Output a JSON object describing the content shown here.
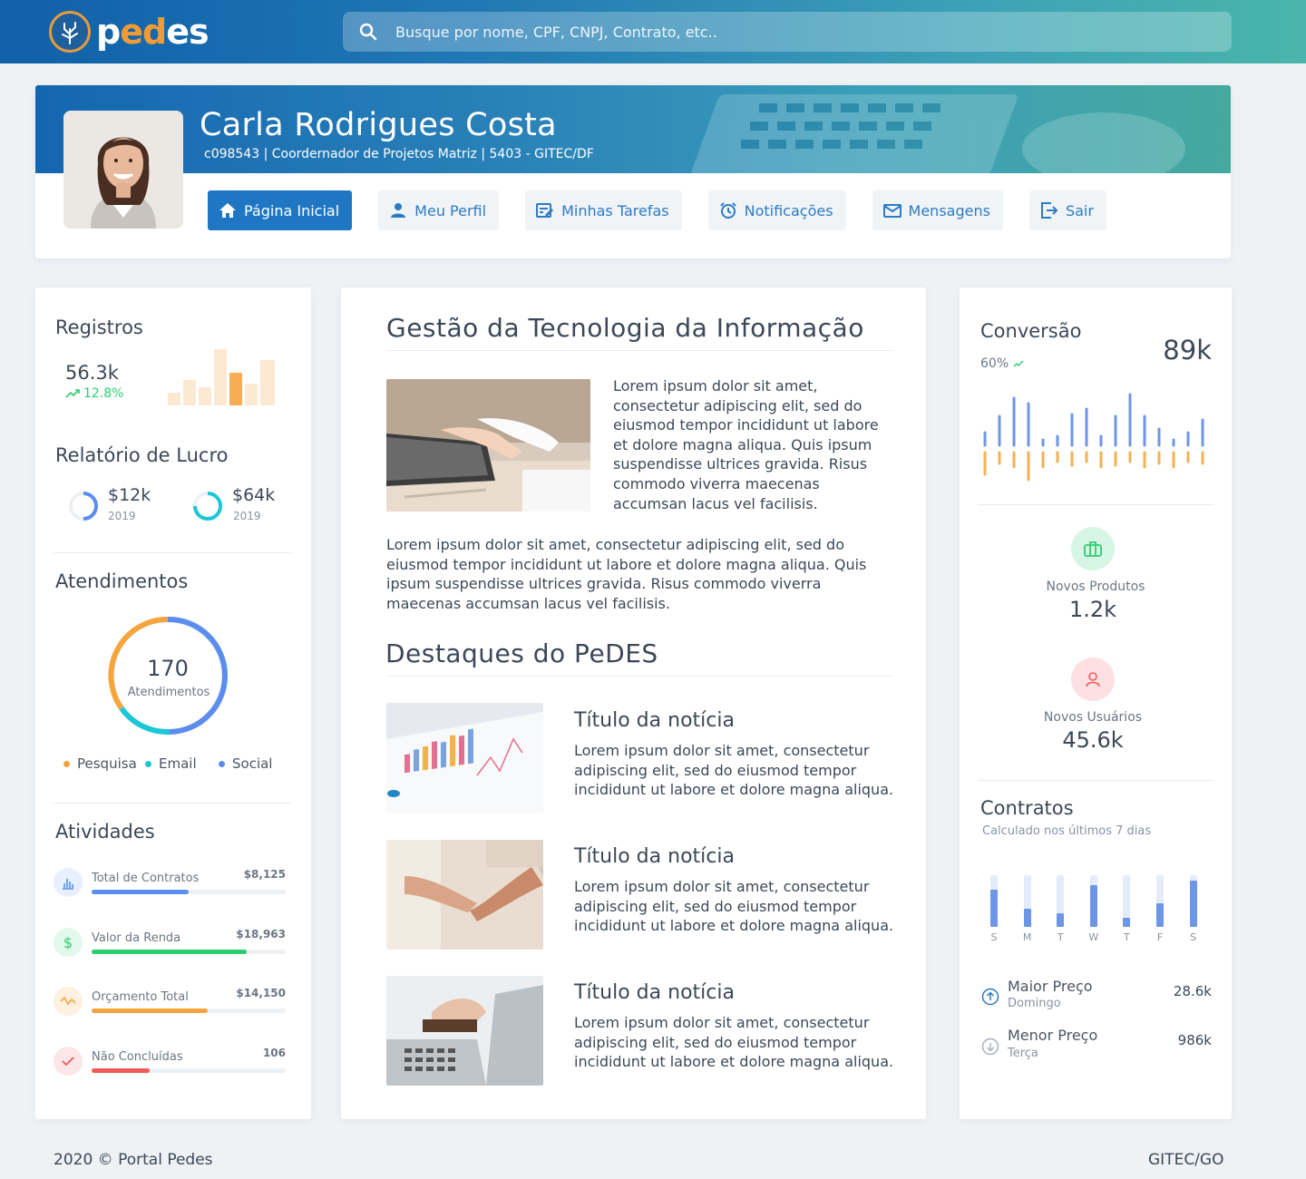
{
  "header": {
    "logo_text_a": "p",
    "logo_text_b": "ed",
    "logo_text_c": "es",
    "search_placeholder": "Busque por nome, CPF, CNPJ, Contrato, etc.."
  },
  "profile": {
    "name": "Carla Rodrigues Costa",
    "subtitle": "c098543 | Coordernador de Projetos Matriz | 5403 - GITEC/DF",
    "nav": [
      {
        "label": "Página Inicial",
        "icon": "home-icon",
        "active": true
      },
      {
        "label": "Meu Perfil",
        "icon": "user-icon"
      },
      {
        "label": "Minhas Tarefas",
        "icon": "tasks-icon"
      },
      {
        "label": "Notificações",
        "icon": "alarm-icon"
      },
      {
        "label": "Mensagens",
        "icon": "mail-icon"
      },
      {
        "label": "Sair",
        "icon": "logout-icon"
      }
    ]
  },
  "left": {
    "registros": {
      "title": "Registros",
      "value": "56.3k",
      "trend": "12.8%"
    },
    "lucro": {
      "title": "Relatório de Lucro",
      "items": [
        {
          "value": "$12k",
          "year": "2019"
        },
        {
          "value": "$64k",
          "year": "2019"
        }
      ]
    },
    "atendimentos": {
      "title": "Atendimentos",
      "total": "170",
      "label": "Atendimentos",
      "legend": [
        "Pesquisa",
        "Email",
        "Social"
      ]
    },
    "atividades": {
      "title": "Atividades",
      "items": [
        {
          "label": "Total de Contratos",
          "value": "$8,125",
          "progress": 0.5
        },
        {
          "label": "Valor da Renda",
          "value": "$18,963",
          "progress": 0.8
        },
        {
          "label": "Orçamento Total",
          "value": "$14,150",
          "progress": 0.6
        },
        {
          "label": "Não Concluídas",
          "value": "106",
          "progress": 0.3
        }
      ]
    }
  },
  "center": {
    "section1_title": "Gestão da Tecnologia da Informação",
    "section1_text_right": "Lorem ipsum dolor sit amet, consectetur adipiscing elit, sed do eiusmod tempor incididunt ut labore et dolore magna aliqua. Quis ipsum suspendisse ultrices gravida. Risus commodo viverra maecenas accumsan lacus vel facilisis.",
    "section1_text_full": "Lorem ipsum dolor sit amet, consectetur adipiscing elit, sed do eiusmod tempor incididunt ut labore et dolore magna aliqua. Quis ipsum suspendisse ultrices gravida. Risus commodo viverra maecenas accumsan lacus vel facilisis.",
    "section2_title": "Destaques do PeDES",
    "news": [
      {
        "title": "Título da notícia",
        "text": "Lorem ipsum dolor sit amet, consectetur adipiscing elit, sed do eiusmod tempor incididunt ut labore et dolore magna aliqua."
      },
      {
        "title": "Título da notícia",
        "text": "Lorem ipsum dolor sit amet, consectetur adipiscing elit, sed do eiusmod tempor incididunt ut labore et dolore magna aliqua."
      },
      {
        "title": "Título da notícia",
        "text": "Lorem ipsum dolor sit amet, consectetur adipiscing elit, sed do eiusmod tempor incididunt ut labore et dolore magna aliqua."
      }
    ]
  },
  "right": {
    "conversao": {
      "title": "Conversão",
      "percent": "60%",
      "value": "89k"
    },
    "novos_produtos": {
      "label": "Novos Produtos",
      "value": "1.2k"
    },
    "novos_usuarios": {
      "label": "Novos Usuários",
      "value": "45.6k"
    },
    "contratos": {
      "title": "Contratos",
      "subtitle": "Calculado nos últimos 7 dias",
      "days": [
        "S",
        "M",
        "T",
        "W",
        "T",
        "F",
        "S"
      ],
      "values": [
        0.8,
        0.4,
        0.3,
        0.9,
        0.2,
        0.5,
        1.0
      ]
    },
    "maior": {
      "label": "Maior Preço",
      "sub": "Domingo",
      "value": "28.6k"
    },
    "menor": {
      "label": "Menor Preço",
      "sub": "Terça",
      "value": "986k"
    }
  },
  "footer": {
    "left": "2020 © Portal Pedes",
    "right": "GITEC/GO"
  },
  "colors": {
    "primary": "#1f77c4",
    "orange": "#f5a53b",
    "teal": "#1cc7d6",
    "blue": "#5b8def",
    "green": "#2ecc71",
    "red": "#f25a5a"
  }
}
